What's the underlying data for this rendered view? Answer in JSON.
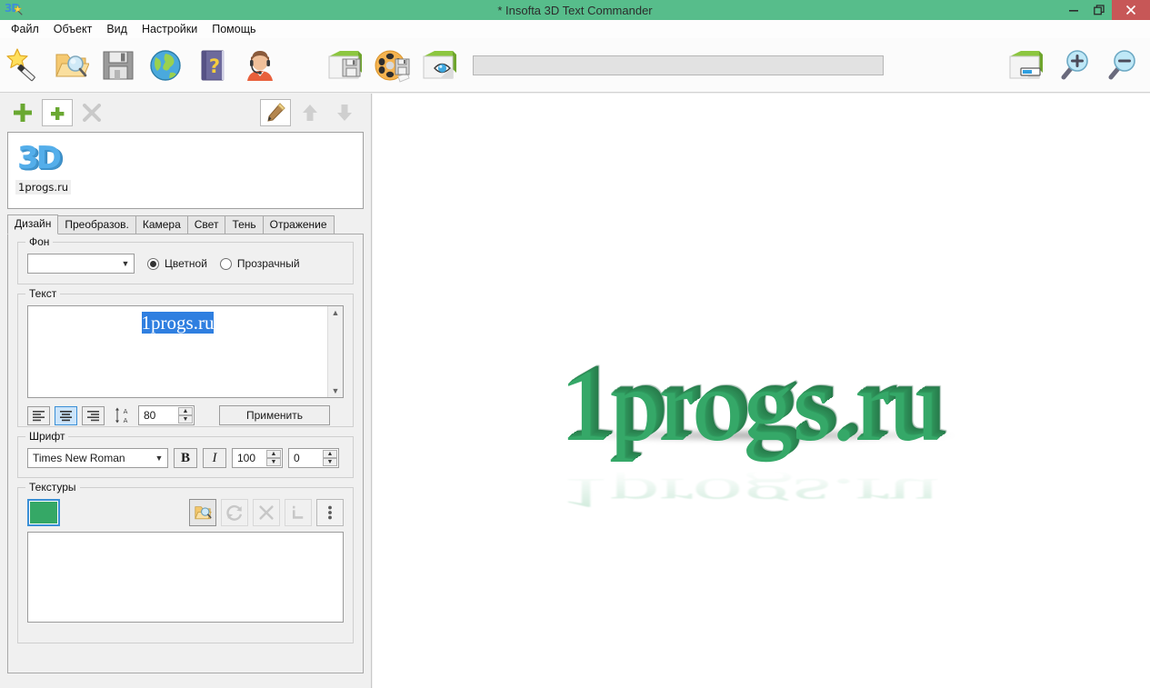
{
  "window": {
    "title": "* Insofta 3D Text Commander",
    "logo_text": "3D",
    "minimize_label": "Minimize",
    "restore_label": "Restore",
    "close_label": "Close"
  },
  "menubar": {
    "items": [
      {
        "label": "Файл",
        "name": "menu-file"
      },
      {
        "label": "Объект",
        "name": "menu-object"
      },
      {
        "label": "Вид",
        "name": "menu-view"
      },
      {
        "label": "Настройки",
        "name": "menu-settings"
      },
      {
        "label": "Помощь",
        "name": "menu-help"
      }
    ]
  },
  "toolbar": {
    "left_buttons": [
      {
        "name": "new-wizard-button",
        "icon": "magic-wand-icon",
        "tooltip": "Мастер"
      },
      {
        "name": "open-button",
        "icon": "open-folder-icon",
        "tooltip": "Открыть"
      },
      {
        "name": "save-button",
        "icon": "floppy-disk-icon",
        "tooltip": "Сохранить"
      },
      {
        "name": "web-button",
        "icon": "globe-icon",
        "tooltip": "Веб-сайт"
      },
      {
        "name": "help-button",
        "icon": "help-book-icon",
        "tooltip": "Справка"
      },
      {
        "name": "support-button",
        "icon": "support-agent-icon",
        "tooltip": "Поддержка"
      }
    ],
    "mid_buttons": [
      {
        "name": "export-image-button",
        "icon": "save-image-icon",
        "tooltip": "Сохранить изображение"
      },
      {
        "name": "export-animation-button",
        "icon": "film-reel-icon",
        "tooltip": "Сохранить анимацию"
      },
      {
        "name": "preview-button",
        "icon": "preview-eye-icon",
        "tooltip": "Просмотр"
      }
    ],
    "path_field_value": "",
    "path_field_placeholder": "",
    "right_buttons": [
      {
        "name": "progress-button",
        "icon": "progress-bar-icon",
        "tooltip": "Прогресс"
      },
      {
        "name": "zoom-in-button",
        "icon": "magnifier-plus-icon",
        "tooltip": "Увеличить"
      },
      {
        "name": "zoom-out-button",
        "icon": "magnifier-minus-icon",
        "tooltip": "Уменьшить"
      }
    ]
  },
  "object_panel": {
    "tools": [
      {
        "name": "add-object-button",
        "icon": "plus-icon",
        "state": "enabled"
      },
      {
        "name": "duplicate-object-button",
        "icon": "plus-on-page-icon",
        "state": "selected"
      },
      {
        "name": "delete-object-button",
        "icon": "close-x-icon",
        "state": "disabled"
      },
      {
        "name": "edit-object-button",
        "icon": "pencil-icon",
        "state": "selected"
      },
      {
        "name": "move-up-button",
        "icon": "arrow-up-icon",
        "state": "disabled"
      },
      {
        "name": "move-down-button",
        "icon": "arrow-down-icon",
        "state": "disabled"
      }
    ],
    "items": [
      {
        "thumb_text": "3D",
        "label": "1progs.ru"
      }
    ]
  },
  "tabs": [
    {
      "label": "Дизайн",
      "name": "tab-design",
      "active": true
    },
    {
      "label": "Преобразов.",
      "name": "tab-transform",
      "active": false
    },
    {
      "label": "Камера",
      "name": "tab-camera",
      "active": false
    },
    {
      "label": "Свет",
      "name": "tab-light",
      "active": false
    },
    {
      "label": "Тень",
      "name": "tab-shadow",
      "active": false
    },
    {
      "label": "Отражение",
      "name": "tab-reflection",
      "active": false
    }
  ],
  "design": {
    "background": {
      "legend": "Фон",
      "color_combo_value": "",
      "radio_colored": "Цветной",
      "radio_transparent": "Прозрачный",
      "selected": "Цветной"
    },
    "text": {
      "legend": "Текст",
      "value": "1progs.ru",
      "selected": true,
      "align_left": "По левому краю",
      "align_center": "По центру",
      "align_right": "По правому краю",
      "align_selected": "center",
      "line_spacing_label": "Межстрочный интервал",
      "line_spacing_value": "80",
      "apply_label": "Применить"
    },
    "font": {
      "legend": "Шрифт",
      "family": "Times New Roman",
      "bold_label": "B",
      "italic_label": "I",
      "size_value": "100",
      "extra_value": "0"
    },
    "textures": {
      "legend": "Текстуры",
      "swatch_color": "#35a866",
      "buttons": [
        {
          "name": "texture-browse-button",
          "icon": "open-folder-magnifier-icon",
          "state": "selected"
        },
        {
          "name": "texture-refresh-button",
          "icon": "refresh-icon",
          "state": "disabled"
        },
        {
          "name": "texture-remove-button",
          "icon": "close-x-icon",
          "state": "disabled"
        },
        {
          "name": "texture-corner-button",
          "icon": "corner-bracket-icon",
          "state": "disabled"
        },
        {
          "name": "texture-more-button",
          "icon": "more-vertical-icon",
          "state": "enabled"
        }
      ],
      "list_items": []
    }
  },
  "viewport": {
    "render_text": "1progs.ru",
    "text_color": "#35a868",
    "background": "#ffffff"
  },
  "colors": {
    "titlebar": "#57bd8b",
    "close_button": "#c75757",
    "accent_blue": "#2f7fe0",
    "green": "#35a866",
    "chrome": "#f0f0f0"
  }
}
